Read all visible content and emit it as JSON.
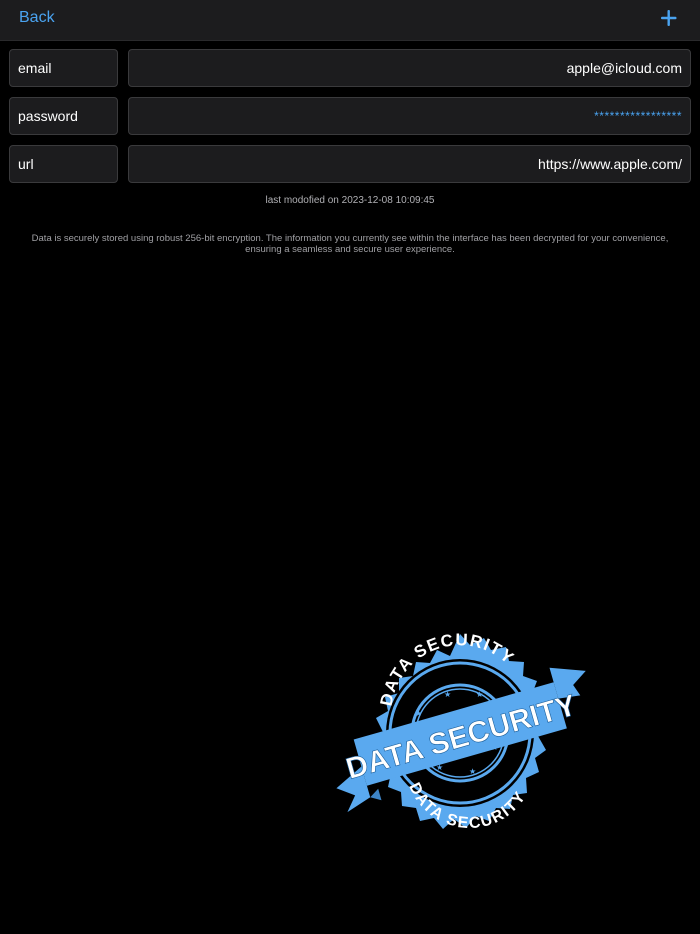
{
  "nav": {
    "back_label": "Back",
    "add_icon": "plus-icon"
  },
  "fields": [
    {
      "label": "email",
      "value": "apple@icloud.com"
    },
    {
      "label": "password",
      "value": "*****************"
    },
    {
      "label": "url",
      "value": "https://www.apple.com/"
    }
  ],
  "last_modified": "last modofied on 2023-12-08 10:09:45",
  "notice": "Data is securely stored using robust 256-bit encryption. The information you currently see within the interface has been decrypted for your convenience, ensuring a seamless and secure user experience.",
  "badge": {
    "text": "DATA SECURITY",
    "icon": "data-security-seal",
    "color": "#5aa9ef"
  },
  "colors": {
    "accent": "#4aa3f0",
    "background": "#000000",
    "field_bg": "#1c1c1e",
    "field_border": "#3a3a3c"
  }
}
